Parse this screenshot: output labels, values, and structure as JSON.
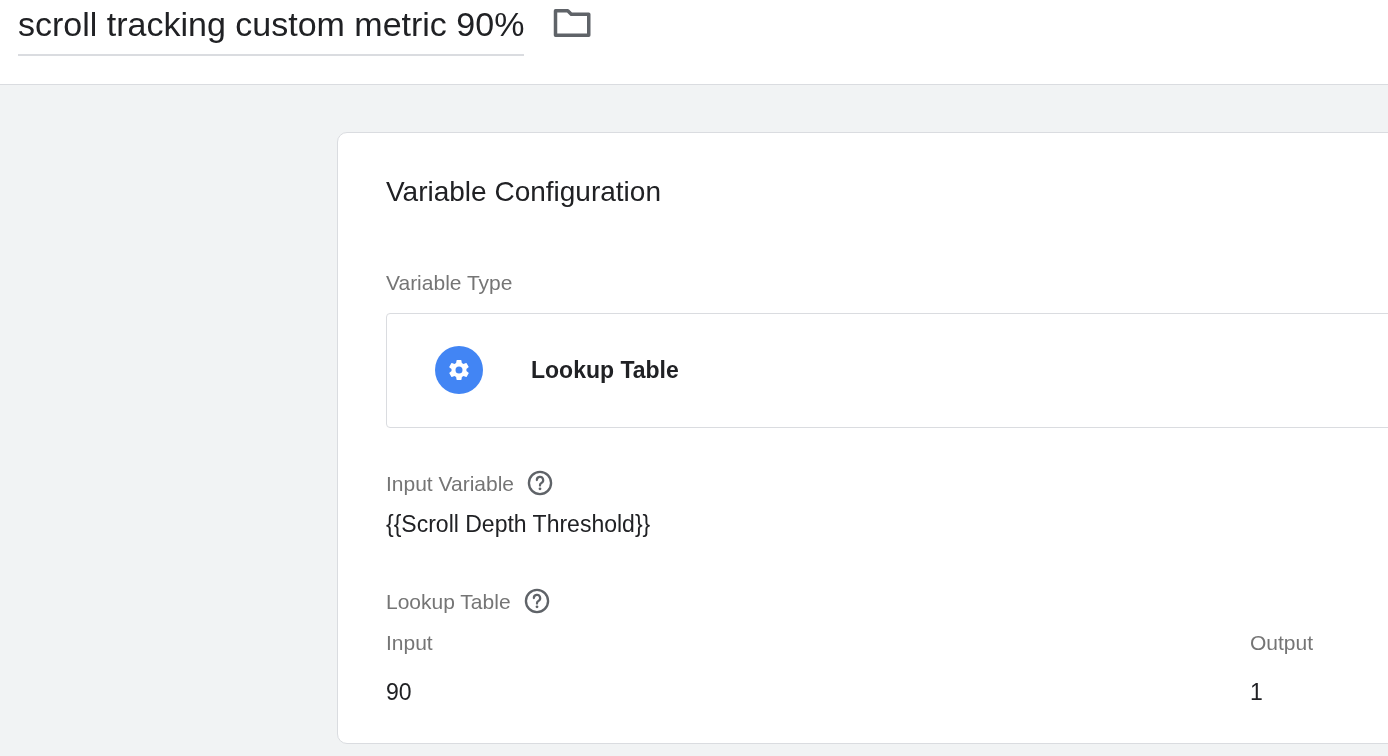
{
  "header": {
    "title": "scroll tracking custom metric 90%"
  },
  "card": {
    "title": "Variable Configuration",
    "variable_type": {
      "label": "Variable Type",
      "value": "Lookup Table"
    },
    "input_variable": {
      "label": "Input Variable",
      "value": "{{Scroll Depth Threshold}}"
    },
    "lookup_table": {
      "label": "Lookup Table",
      "columns": [
        "Input",
        "Output"
      ],
      "rows": [
        [
          "90",
          "1"
        ]
      ]
    }
  }
}
